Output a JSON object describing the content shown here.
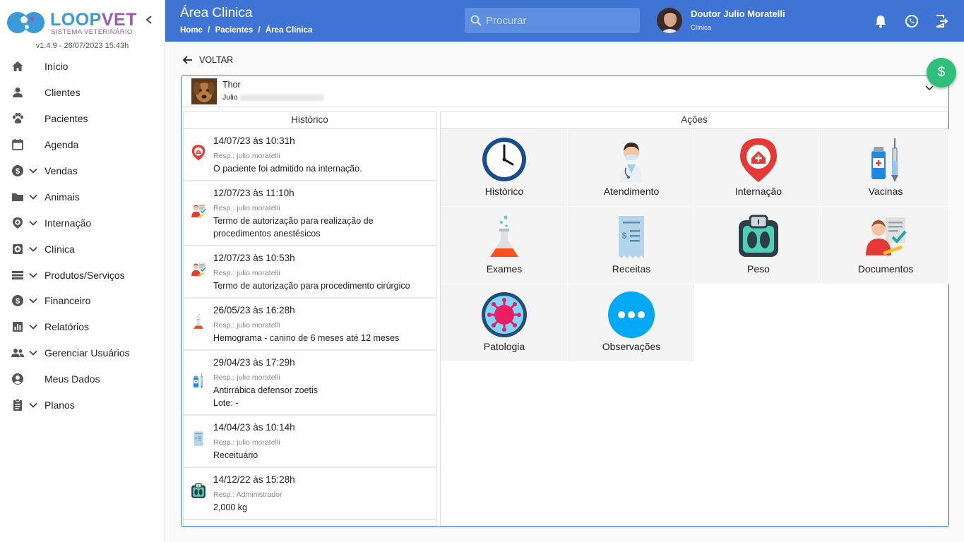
{
  "brand": {
    "name_a": "LOOP",
    "name_b": "VET",
    "subtitle": "SISTEMA VETERINÁRIO",
    "version": "v1.4.9 - 26/07/2023 15:43h"
  },
  "sidebar": {
    "items": [
      {
        "label": "Início",
        "icon": "home-icon",
        "caret": false
      },
      {
        "label": "Clientes",
        "icon": "person-icon",
        "caret": false
      },
      {
        "label": "Pacientes",
        "icon": "paw-icon",
        "caret": false
      },
      {
        "label": "Agenda",
        "icon": "calendar-icon",
        "caret": false
      },
      {
        "label": "Vendas",
        "icon": "dollar-icon",
        "caret": true
      },
      {
        "label": "Animais",
        "icon": "folder-icon",
        "caret": true
      },
      {
        "label": "Internação",
        "icon": "location-plus-icon",
        "caret": true
      },
      {
        "label": "Clínica",
        "icon": "medical-box-icon",
        "caret": true
      },
      {
        "label": "Produtos/Serviços",
        "icon": "list-icon",
        "caret": true
      },
      {
        "label": "Financeiro",
        "icon": "dollar-icon",
        "caret": true
      },
      {
        "label": "Relatórios",
        "icon": "chart-icon",
        "caret": true
      },
      {
        "label": "Gerenciar Usuários",
        "icon": "group-icon",
        "caret": true
      },
      {
        "label": "Meus Dados",
        "icon": "account-circle-icon",
        "caret": false
      },
      {
        "label": "Planos",
        "icon": "clipboard-icon",
        "caret": true
      }
    ]
  },
  "header": {
    "title": "Área Clinica",
    "breadcrumb": [
      "Home",
      "/",
      "Pacientes",
      "/",
      "Área Clínica"
    ],
    "search_placeholder": "Procurar",
    "user_name": "Doutor Julio Moratelli",
    "user_role": "Clínica"
  },
  "main": {
    "back_label": "VOLTAR",
    "fab_symbol": "$",
    "pet_name": "Thor",
    "owner_first": "Julio",
    "history_title": "Histórico",
    "actions_title": "Ações"
  },
  "history": [
    {
      "date": "14/07/23 às 10:31h",
      "resp": "Resp.: julio moratelli",
      "desc": "O paciente foi admitido na internação.",
      "icon": "hospital-pin-icon"
    },
    {
      "date": "12/07/23 às 11:10h",
      "resp": "Resp.: julio moratelli",
      "desc": "Termo de autorização para realização de procedimentos anestésicos",
      "icon": "document-person-icon"
    },
    {
      "date": "12/07/23 às 10:53h",
      "resp": "Resp.: julio moratelli",
      "desc": "Termo de autorização para procedimento cirúrgico",
      "icon": "document-person-icon"
    },
    {
      "date": "26/05/23 às 16:28h",
      "resp": "Resp.: julio moratelli",
      "desc": "Hemograma - canino de 6 meses até 12 meses",
      "icon": "flask-icon"
    },
    {
      "date": "29/04/23 às 17:29h",
      "resp": "Resp.: julio moratelli",
      "desc": "Antirrábica defensor zoetis",
      "desc2": "Lote: -",
      "icon": "vaccine-icon"
    },
    {
      "date": "14/04/23 às 10:14h",
      "resp": "Resp.: julio moratelli",
      "desc": "Receituário",
      "icon": "receipt-icon"
    },
    {
      "date": "14/12/22 às 15:28h",
      "resp": "Resp.: Administrador",
      "desc": "2,000 kg",
      "icon": "scale-icon"
    }
  ],
  "actions": [
    {
      "label": "Histórico",
      "icon": "clock-icon"
    },
    {
      "label": "Atendimento",
      "icon": "doctor-icon"
    },
    {
      "label": "Internação",
      "icon": "hospital-pin-icon"
    },
    {
      "label": "Vacinas",
      "icon": "vaccine-icon"
    },
    {
      "label": "Exames",
      "icon": "flask-icon"
    },
    {
      "label": "Receitas",
      "icon": "receipt-icon"
    },
    {
      "label": "Peso",
      "icon": "scale-icon"
    },
    {
      "label": "Documentos",
      "icon": "document-person-icon"
    },
    {
      "label": "Patologia",
      "icon": "virus-icon"
    },
    {
      "label": "Observações",
      "icon": "more-icon"
    }
  ],
  "colors": {
    "primary": "#3f74d4",
    "fab": "#2ebf7a",
    "brand_blue": "#3a9ad9",
    "brand_purple": "#9b59b6"
  }
}
